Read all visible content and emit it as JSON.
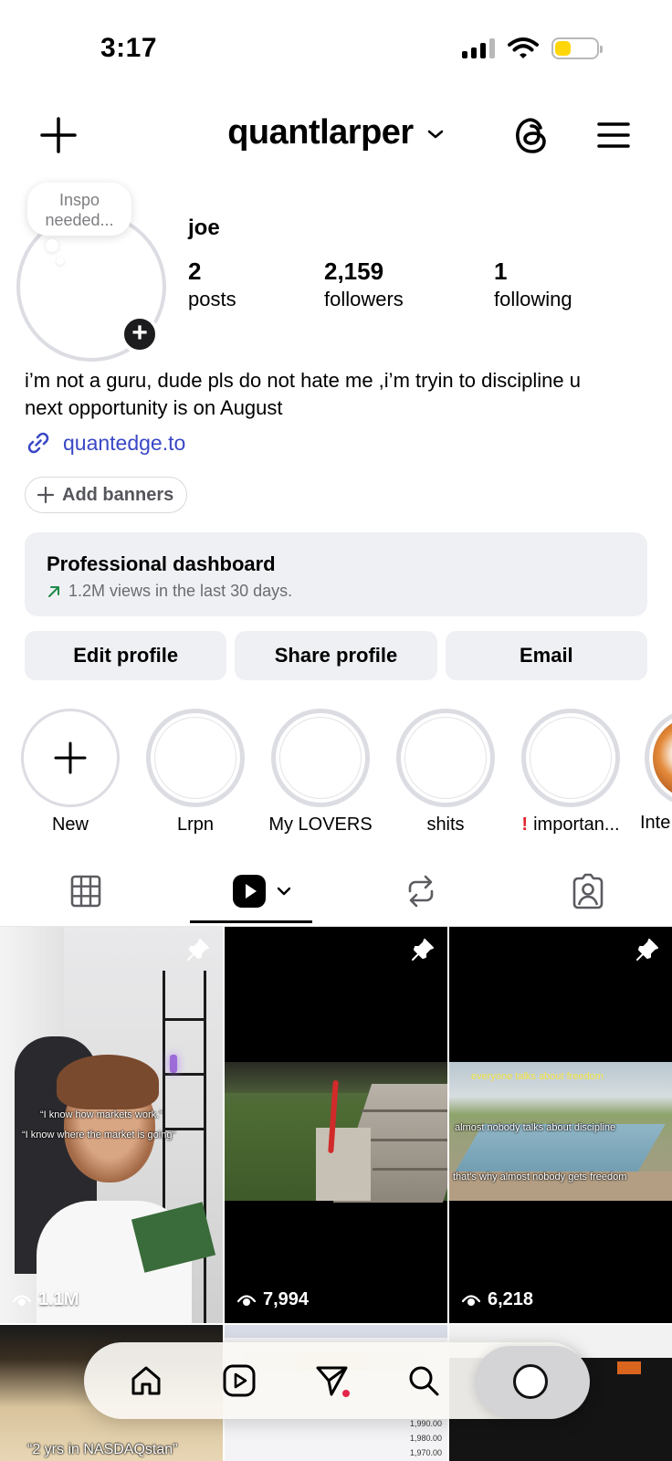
{
  "status_bar": {
    "time": "3:17"
  },
  "header": {
    "username": "quantlarper"
  },
  "note": {
    "text": "Inspo needed..."
  },
  "profile": {
    "name": "joe",
    "stats": [
      {
        "value": "2",
        "label": "posts"
      },
      {
        "value": "2,159",
        "label": "followers"
      },
      {
        "value": "1",
        "label": "following"
      }
    ],
    "bio_line1": "i’m not a guru, dude pls do not hate me ,i’m tryin to discipline u",
    "bio_line2": "next opportunity is on August",
    "link": "quantedge.to"
  },
  "add_banners_label": "Add banners",
  "dashboard": {
    "title": "Professional dashboard",
    "subtitle": "1.2M views in the last 30 days."
  },
  "actions": {
    "edit": "Edit profile",
    "share": "Share profile",
    "email": "Email"
  },
  "highlights": [
    {
      "label": "New"
    },
    {
      "label": "Lrpn"
    },
    {
      "label": "My LOVERS"
    },
    {
      "label": "shits"
    },
    {
      "label": "importan..."
    },
    {
      "label": "Inte"
    }
  ],
  "grid": [
    {
      "views": "1.1M",
      "pinned": true,
      "caption_1": "“I know how markets work.”",
      "caption_2": "“I know where the market is going”"
    },
    {
      "views": "7,994",
      "pinned": true
    },
    {
      "views": "6,218",
      "pinned": true,
      "caption_1": "everyone talks about freedom",
      "caption_2": "almost nobody talks about discipline",
      "caption_3": "that's why almost nobody gets freedom"
    },
    {
      "caption_1": "“2 yrs in NASDAQstan”"
    },
    {
      "prices": [
        "1,990.00",
        "1,980.00",
        "1,970.00"
      ]
    },
    {}
  ],
  "colors": {
    "accent_link": "#3a48c5",
    "battery": "#ffd60a",
    "warning": "#e0212b",
    "notification_dot": "#e4264a"
  }
}
